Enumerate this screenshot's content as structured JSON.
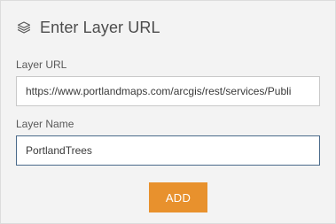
{
  "header": {
    "icon": "layers-icon",
    "title": "Enter Layer URL"
  },
  "form": {
    "url_label": "Layer URL",
    "url_value": "https://www.portlandmaps.com/arcgis/rest/services/Publi",
    "name_label": "Layer Name",
    "name_value": "PortlandTrees",
    "add_label": "ADD"
  },
  "colors": {
    "accent": "#e8912d",
    "focus_border": "#4a6a8a",
    "panel_bg": "#f3f3f3"
  }
}
